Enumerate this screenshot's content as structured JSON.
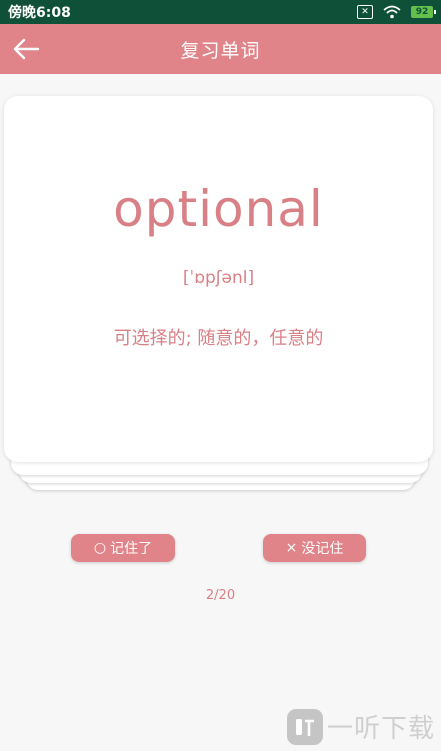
{
  "status_bar": {
    "time": "傍晚6:08",
    "battery": "92",
    "sim_label": "✕"
  },
  "header": {
    "title": "复习单词"
  },
  "card": {
    "word": "optional",
    "phonetic": "[ˈɒpʃənl]",
    "meaning": "可选择的; 随意的，任意的"
  },
  "actions": {
    "remember_icon": "○",
    "remember_label": "记住了",
    "forget_icon": "×",
    "forget_label": "没记住"
  },
  "progress": "2/20",
  "watermark": {
    "text": "一听下载"
  },
  "colors": {
    "status_bar_bg": "#0F5138",
    "accent": "#E0848A",
    "text_accent": "#D98086"
  }
}
